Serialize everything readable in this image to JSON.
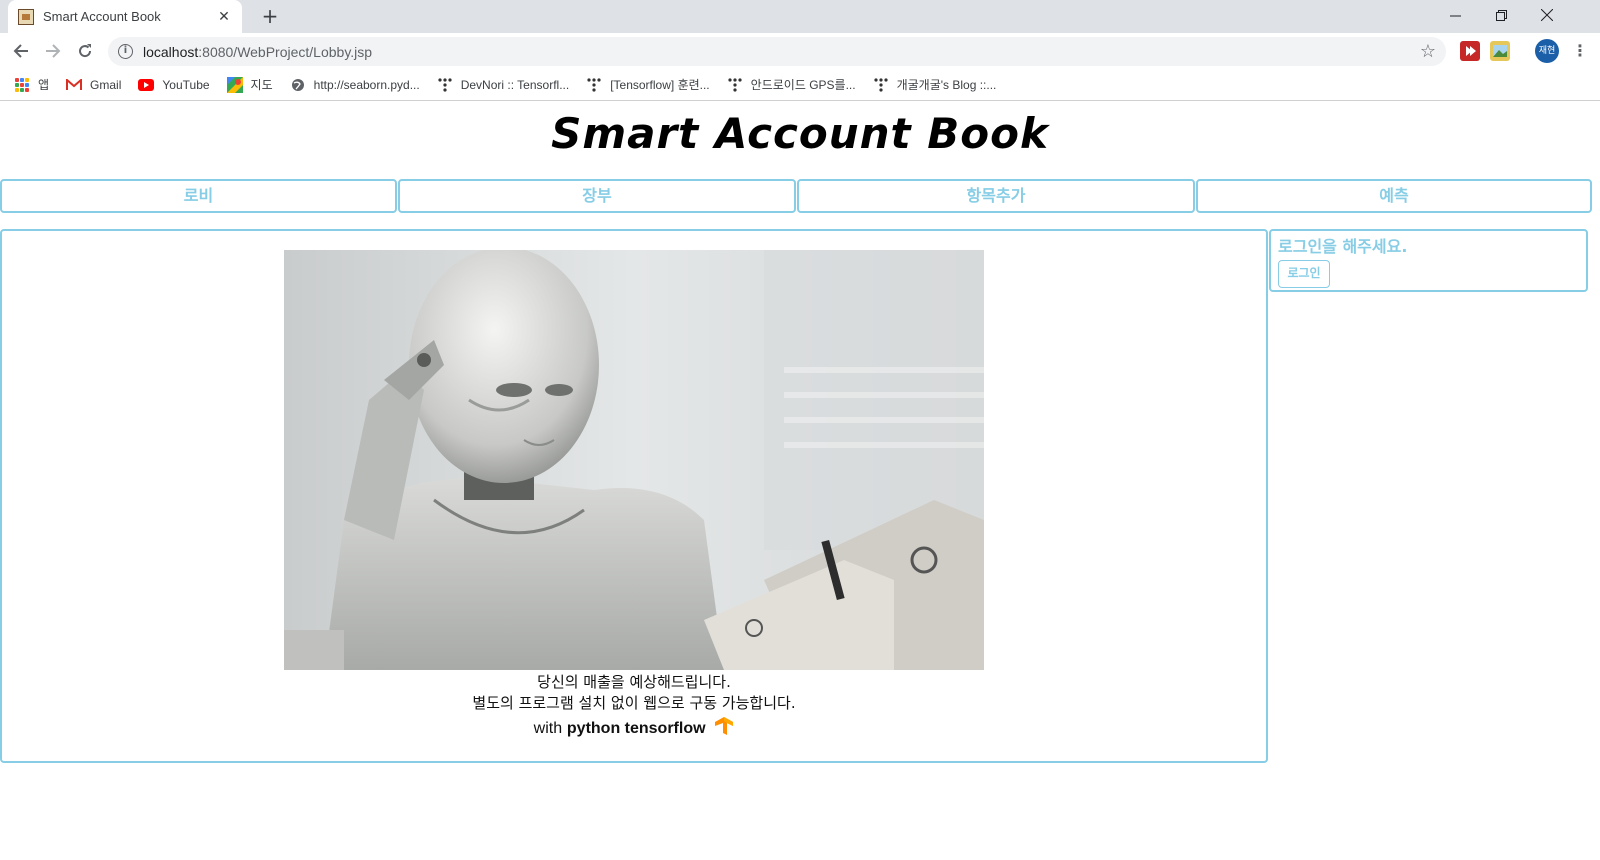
{
  "browser": {
    "tab_title": "Smart Account Book",
    "new_tab_symbol": "+",
    "url_host": "localhost",
    "url_path": ":8080/WebProject/Lobby.jsp",
    "profile_label": "재현"
  },
  "bookmarks": [
    {
      "label": "앱",
      "icon": "apps-icon"
    },
    {
      "label": "Gmail",
      "icon": "gmail-icon"
    },
    {
      "label": "YouTube",
      "icon": "youtube-icon"
    },
    {
      "label": "지도",
      "icon": "maps-icon"
    },
    {
      "label": "http://seaborn.pyd...",
      "icon": "globe-icon"
    },
    {
      "label": "DevNori :: Tensorfl...",
      "icon": "tistory-icon"
    },
    {
      "label": "[Tensorflow] 훈련...",
      "icon": "tistory-icon"
    },
    {
      "label": "안드로이드 GPS를...",
      "icon": "tistory-icon"
    },
    {
      "label": "개굴개굴's Blog ::...",
      "icon": "tistory-icon"
    }
  ],
  "site": {
    "title": "Smart Account Book",
    "menu": [
      "로비",
      "장부",
      "항목추가",
      "예측"
    ],
    "caption_line1": "당신의 매출을 예상해드립니다.",
    "caption_line2": "별도의 프로그램 설치 없이 웹으로 구동 가능합니다.",
    "caption_with": "with",
    "caption_tech": "python tensorflow",
    "hero_image": "robot-thinking-image"
  },
  "sidebar": {
    "message": "로그인을 해주세요.",
    "login_button": "로그인"
  },
  "colors": {
    "accent": "#87cde6",
    "chrome_bg": "#dee1e6"
  }
}
